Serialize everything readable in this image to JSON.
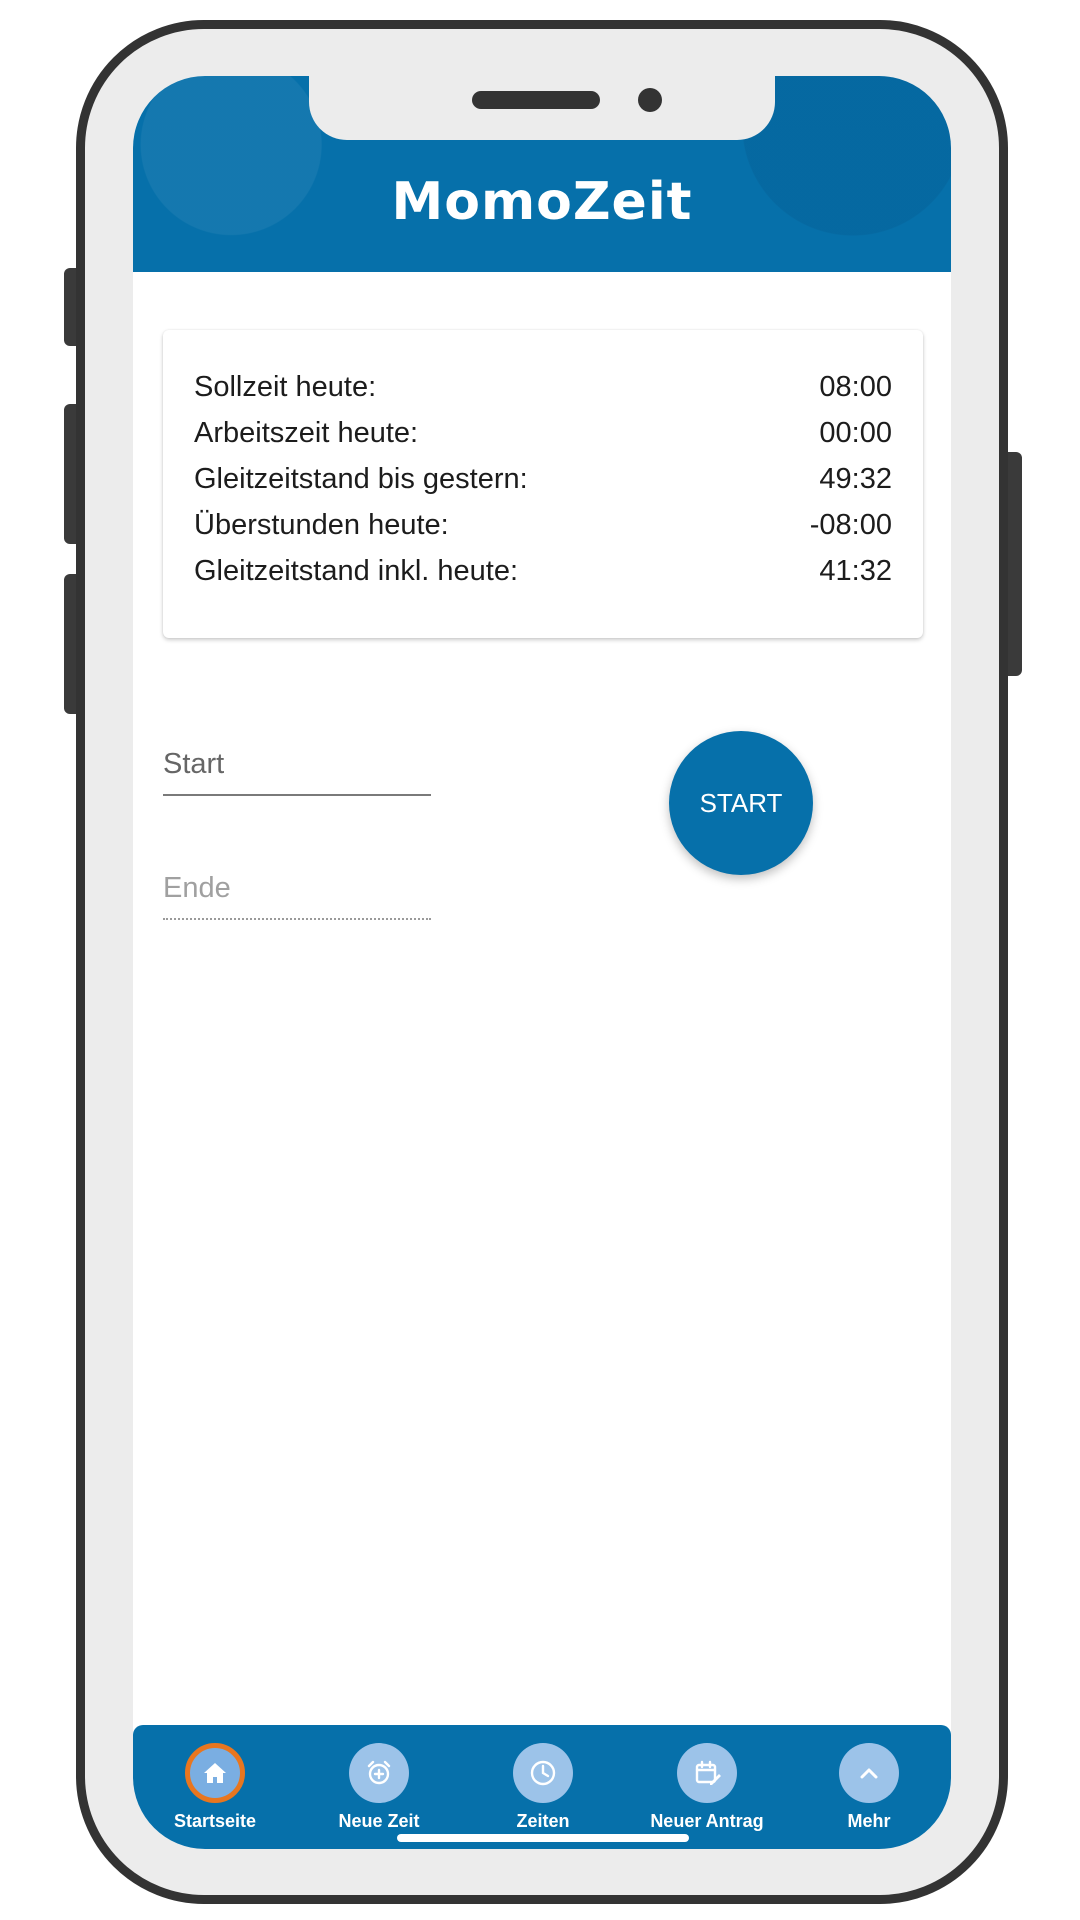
{
  "app": {
    "title": "MomoZeit"
  },
  "summary": {
    "rows": [
      {
        "label": "Sollzeit heute:",
        "value": "08:00"
      },
      {
        "label": "Arbeitszeit heute:",
        "value": "00:00"
      },
      {
        "label": "Gleitzeitstand bis gestern:",
        "value": "49:32"
      },
      {
        "label": "Überstunden heute:",
        "value": "-08:00"
      },
      {
        "label": "Gleitzeitstand inkl. heute:",
        "value": "41:32"
      }
    ]
  },
  "form": {
    "start_placeholder": "Start",
    "end_placeholder": "Ende",
    "start_button": "START"
  },
  "nav": {
    "items": [
      {
        "label": "Startseite",
        "icon": "home-icon",
        "active": true
      },
      {
        "label": "Neue Zeit",
        "icon": "alarm-add-icon",
        "active": false
      },
      {
        "label": "Zeiten",
        "icon": "clock-icon",
        "active": false
      },
      {
        "label": "Neuer Antrag",
        "icon": "calendar-edit-icon",
        "active": false
      },
      {
        "label": "Mehr",
        "icon": "chevron-up-icon",
        "active": false
      }
    ]
  },
  "colors": {
    "primary": "#0670aa",
    "nav_icon_bg": "#9cc3e9",
    "active_ring": "#e8761f"
  }
}
